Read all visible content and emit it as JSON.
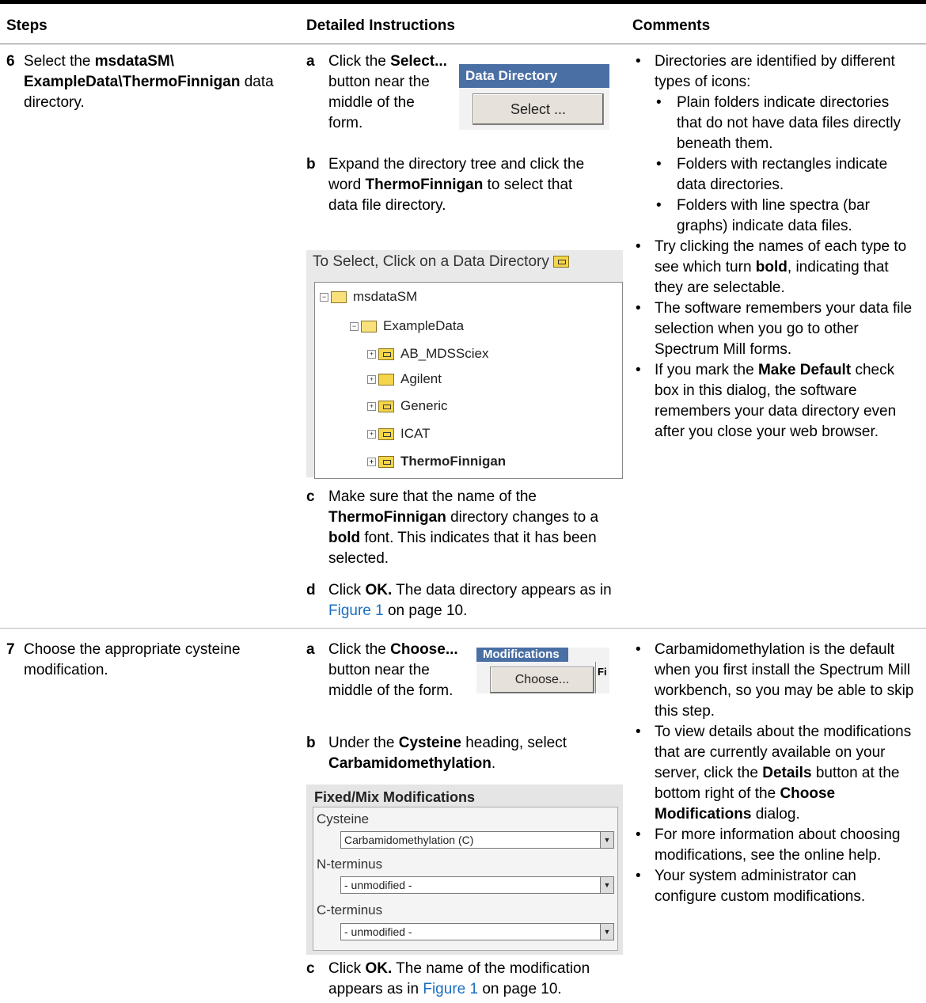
{
  "headers": {
    "steps": "Steps",
    "instructions": "Detailed Instructions",
    "comments": "Comments"
  },
  "step6": {
    "number": "6",
    "text_prefix": "Select the ",
    "path_bold": "msdataSM\\ ExampleData\\ThermoFinnigan",
    "text_suffix": "data directory.",
    "a_letter": "a",
    "a_text1": "Click the",
    "a_bold": "Select...",
    "a_text2": "button near the middle of the form.",
    "b_letter": "b",
    "b_text1": "Expand the directory tree and click the word",
    "b_bold": "ThermoFinnigan",
    "b_text2": "to select that data file directory.",
    "c_letter": "c",
    "c_text1": "Make sure that the name of the",
    "c_bold1": "ThermoFinnigan",
    "c_text2": "directory changes to a",
    "c_bold2": "bold",
    "c_text3": "font. This indicates that it has been selected.",
    "d_letter": "d",
    "d_text1": "Click",
    "d_bold": "OK.",
    "d_text2": "The data directory appears as in",
    "d_link": "Figure 1",
    "d_text3": "on page 10.",
    "widget_title": "Data Directory",
    "widget_button": "Select ...",
    "tree_title": "To Select, Click on a Data Directory",
    "tree_nodes": [
      "msdataSM",
      "ExampleData",
      "AB_MDSSciex",
      "Agilent",
      "Generic",
      "ICAT",
      "ThermoFinnigan"
    ],
    "comments": {
      "c1": "Directories are identified by different types of icons:",
      "s1": "Plain folders indicate directories that do not have data files directly beneath them.",
      "s2": "Folders with rectangles indicate data directories.",
      "s3": "Folders with line spectra (bar graphs) indicate data files.",
      "c2_a": "Try clicking the names of each type to see which turn",
      "c2_bold": "bold",
      "c2_b": ", indicating that they are selectable.",
      "c3": "The software remembers your data file selection when you go to other Spectrum Mill forms.",
      "c4_a": "If you mark the",
      "c4_bold": "Make Default",
      "c4_b": "check box in this dialog, the software remembers your data directory even after you close your web browser."
    }
  },
  "step7": {
    "number": "7",
    "text": "Choose the appropriate cysteine modification.",
    "a_letter": "a",
    "a_text1": "Click the",
    "a_bold": "Choose...",
    "a_text2": "button near the middle of the form.",
    "b_letter": "b",
    "b_text1": "Under the",
    "b_bold1": "Cysteine",
    "b_text2": "heading, select",
    "b_bold2": "Carbamidomethylation",
    "b_text3": ".",
    "c_letter": "c",
    "c_text1": "Click",
    "c_bold": "OK.",
    "c_text2": "The name of the modification appears as in",
    "c_link": "Figure 1",
    "c_text3": "on page 10.",
    "widget_title": "Modifications",
    "widget_button": "Choose...",
    "widget_side": "Fi",
    "panel_title": "Fixed/Mix Modifications",
    "fields": [
      {
        "label": "Cysteine",
        "value": "Carbamidomethylation (C)"
      },
      {
        "label": "N-terminus",
        "value": "- unmodified -"
      },
      {
        "label": "C-terminus",
        "value": "- unmodified -"
      }
    ],
    "comments": {
      "c1": "Carbamidomethylation is the default when you first install the Spectrum Mill workbench, so you may be able to skip this step.",
      "c2_a": "To view details about the modifications that are currently available on your server, click the",
      "c2_bold1": "Details",
      "c2_b": "button at the bottom right of the",
      "c2_bold2": "Choose Modifications",
      "c2_c": "dialog.",
      "c3": "For more information about choosing modifications, see the online help.",
      "c4": "Your system administrator can configure custom modifications."
    }
  }
}
